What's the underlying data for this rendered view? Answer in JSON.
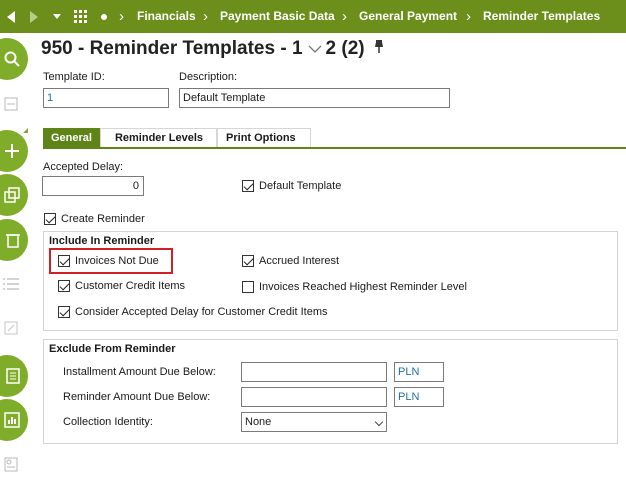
{
  "nav": {
    "breadcrumbs": [
      "Financials",
      "Payment Basic Data",
      "General Payment",
      "Reminder Templates"
    ],
    "icons": [
      "back-arrow-icon",
      "forward-arrow-icon",
      "dropdown-caret-icon",
      "apps-grid-icon",
      "dot-icon"
    ]
  },
  "toolbar": {
    "icons": [
      "search-icon",
      "edit-icon",
      "add-icon",
      "duplicate-icon",
      "delete-icon",
      "list-icon",
      "expand-icon",
      "report-icon",
      "chart-icon",
      "details-icon"
    ]
  },
  "header": {
    "title_prefix": "950 - Reminder Templates - 1",
    "record_nav": "2 (2)"
  },
  "form": {
    "template_id_label": "Template ID:",
    "template_id_value": "1",
    "description_label": "Description:",
    "description_value": "Default Template"
  },
  "tabs": [
    {
      "label": "General",
      "active": true
    },
    {
      "label": "Reminder Levels",
      "active": false
    },
    {
      "label": "Print Options",
      "active": false
    }
  ],
  "general": {
    "accepted_delay_label": "Accepted Delay:",
    "accepted_delay_value": "0",
    "default_template_label": "Default Template",
    "default_template_checked": true,
    "create_reminder_label": "Create Reminder",
    "create_reminder_checked": true
  },
  "include": {
    "title": "Include In Reminder",
    "invoices_not_due": "Invoices Not Due",
    "accrued_interest": "Accrued Interest",
    "customer_credit_items": "Customer Credit Items",
    "invoices_highest_level": "Invoices Reached Highest Reminder Level",
    "consider_delay": "Consider Accepted Delay for Customer Credit Items",
    "checked": {
      "invoices_not_due": true,
      "accrued_interest": true,
      "customer_credit_items": true,
      "invoices_highest_level": false,
      "consider_delay": true
    }
  },
  "exclude": {
    "title": "Exclude From Reminder",
    "installment_label": "Installment Amount Due Below:",
    "installment_value": "",
    "installment_currency": "PLN",
    "reminder_label": "Reminder Amount Due Below:",
    "reminder_value": "",
    "reminder_currency": "PLN",
    "collection_label": "Collection Identity:",
    "collection_value": "None"
  },
  "colors": {
    "brand_green": "#6b8f1a",
    "tab_active": "#5e8418",
    "toolbar_green": "#7fad2a",
    "highlight_red": "#d21f26",
    "link_blue": "#1f6fa5"
  }
}
